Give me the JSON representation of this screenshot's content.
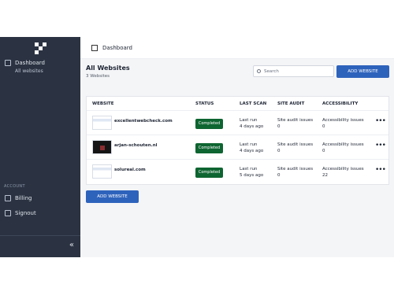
{
  "sidebar": {
    "nav": [
      {
        "label": "Dashboard",
        "icon": "chart-icon"
      },
      {
        "label": "Billing",
        "icon": "card-icon"
      },
      {
        "label": "Signout",
        "icon": "signout-icon"
      }
    ],
    "dashboard_sub": "All websites",
    "account_label": "ACCOUNT",
    "collapse_icon": "«"
  },
  "header": {
    "title": "Dashboard"
  },
  "main": {
    "title": "All Websites",
    "subtitle": "3 Websites",
    "search_placeholder": "Search",
    "add_top_label": "ADD WEBSITE",
    "add_bottom_label": "ADD WEBSITE"
  },
  "table": {
    "columns": [
      "WEBSITE",
      "STATUS",
      "LAST SCAN",
      "SITE AUDIT",
      "ACCESSIBILITY"
    ],
    "rows": [
      {
        "site": "excellentwebcheck.com",
        "status": "Completed",
        "last_run_label": "Last run",
        "last_run": "4 days ago",
        "audit_label": "Site audit issues",
        "audit": "0",
        "access_label": "Accessibility issues",
        "access": "0"
      },
      {
        "site": "arjan-schouten.nl",
        "status": "Completed",
        "last_run_label": "Last run",
        "last_run": "4 days ago",
        "audit_label": "Site audit issues",
        "audit": "0",
        "access_label": "Accessibility issues",
        "access": "0"
      },
      {
        "site": "solureal.com",
        "status": "Completed",
        "last_run_label": "Last run",
        "last_run": "5 days ago",
        "audit_label": "Site audit issues",
        "audit": "0",
        "access_label": "Accessibility issues",
        "access": "22"
      }
    ],
    "more_icon": "•••"
  },
  "colors": {
    "sidebar": "#2b3342",
    "button": "#2e63bc",
    "status": "#0e6531",
    "background": "#f4f5f7"
  }
}
